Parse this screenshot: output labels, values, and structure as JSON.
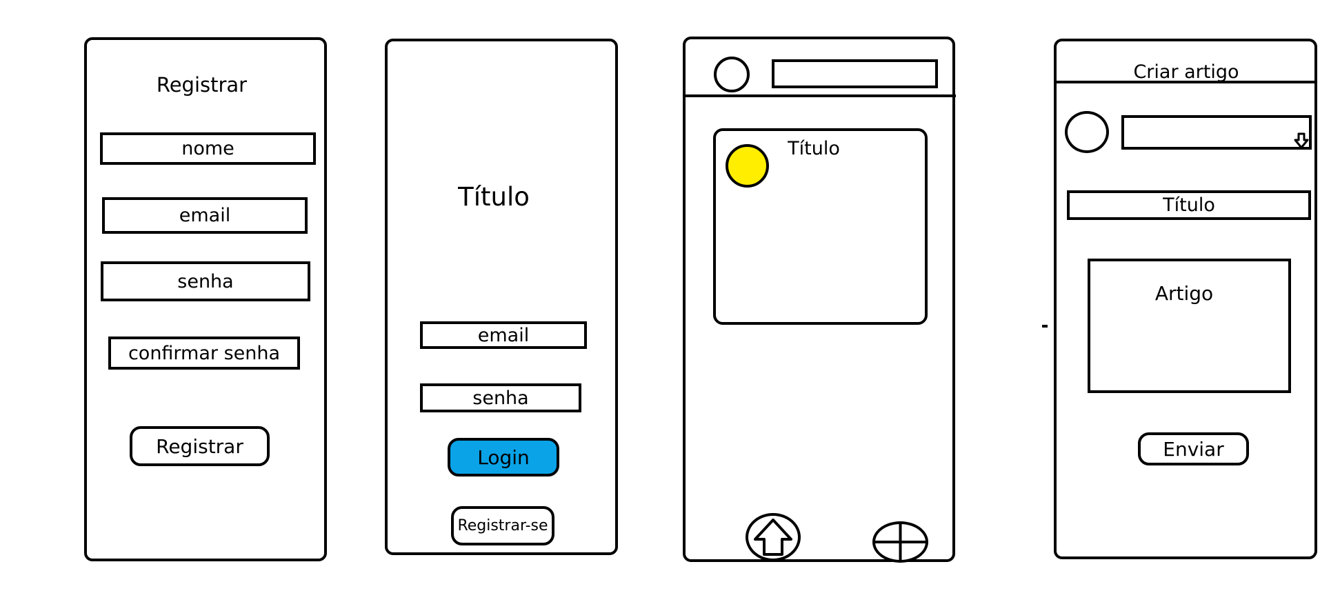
{
  "register_screen": {
    "heading": "Registrar",
    "fields": [
      "nome",
      "email",
      "senha",
      "confirmar senha"
    ],
    "submit_label": "Registrar"
  },
  "login_screen": {
    "title": "Título",
    "email_label": "email",
    "password_label": "senha",
    "login_label": "Login",
    "register_label": "Registrar-se"
  },
  "feed_screen": {
    "card_title": "Título",
    "bottom_nav": {
      "home_icon": "home-arrow-icon",
      "add_icon": "plus-circle-icon"
    }
  },
  "create_screen": {
    "header_title": "Criar artigo",
    "title_label": "Título",
    "article_label": "Artigo",
    "send_label": "Enviar"
  },
  "colors": {
    "login_button": "#0aa3e8",
    "avatar_yellow": "#ffee00",
    "stroke": "#000000"
  }
}
